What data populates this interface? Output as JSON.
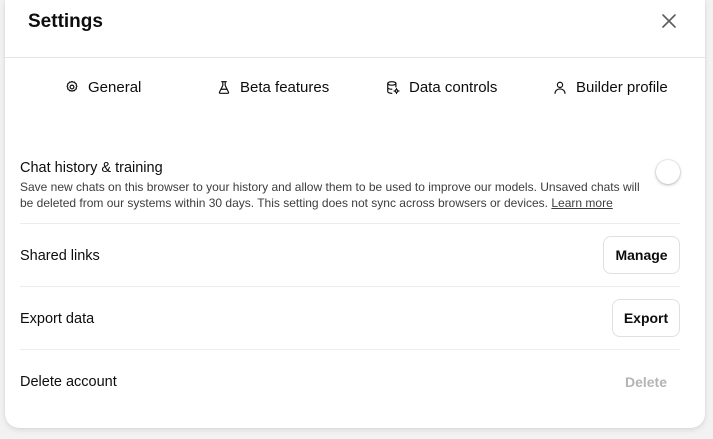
{
  "dialog": {
    "title": "Settings",
    "close_icon": "close-icon"
  },
  "tabs": [
    {
      "label": "General",
      "icon": "gear-icon"
    },
    {
      "label": "Beta features",
      "icon": "flask-icon"
    },
    {
      "label": "Data controls",
      "icon": "database-icon"
    },
    {
      "label": "Builder profile",
      "icon": "user-icon"
    }
  ],
  "settings": {
    "chat_history": {
      "label": "Chat history & training",
      "description": "Save new chats on this browser to your history and allow them to be used to improve our models. Unsaved chats will be deleted from our systems within 30 days. This setting does not sync across browsers or devices.",
      "learn_more": "Learn more",
      "enabled": false
    },
    "shared_links": {
      "label": "Shared links",
      "button": "Manage"
    },
    "export_data": {
      "label": "Export data",
      "button": "Export"
    },
    "delete_account": {
      "label": "Delete account",
      "button": "Delete"
    }
  },
  "colors": {
    "text": "#0d0d0d",
    "muted": "#3d3d3d",
    "disabled": "#b4b4b4",
    "border": "#e0e0e0"
  }
}
